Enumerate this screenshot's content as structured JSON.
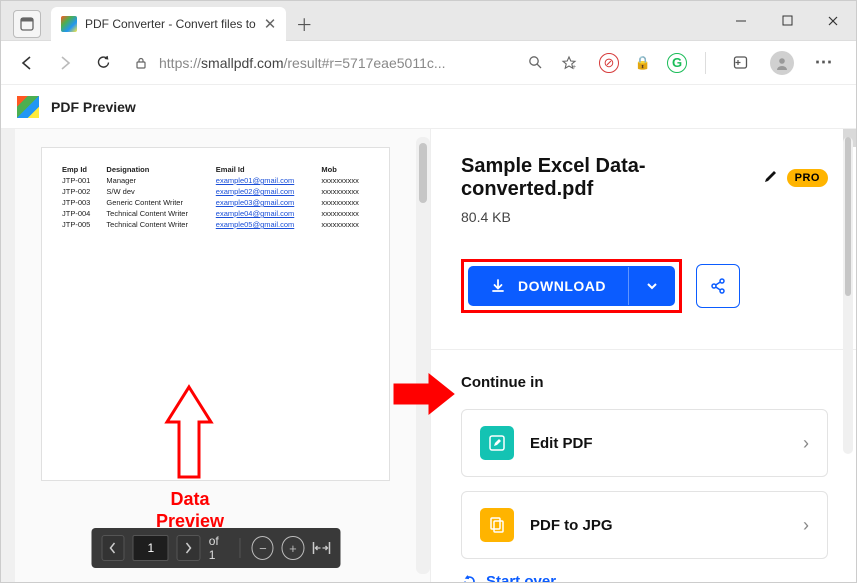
{
  "window": {
    "tab_title": "PDF Converter - Convert files to ",
    "url_prefix": "https://",
    "url_host": "smallpdf.com",
    "url_path": "/result#r=5717eae5011c..."
  },
  "app": {
    "title": "PDF Preview"
  },
  "preview": {
    "columns": [
      "Emp Id",
      "Designation",
      "Email Id",
      "Mob"
    ],
    "rows": [
      {
        "id": "JTP-001",
        "desig": "Manager",
        "email": "example01@gmail.com",
        "mob": "xxxxxxxxxx"
      },
      {
        "id": "JTP-002",
        "desig": "S/W dev",
        "email": "example02@gmail.com",
        "mob": "xxxxxxxxxx"
      },
      {
        "id": "JTP-003",
        "desig": "Generic Content Writer",
        "email": "example03@gmail.com",
        "mob": "xxxxxxxxxx"
      },
      {
        "id": "JTP-004",
        "desig": "Technical Content Writer",
        "email": "example04@gmail.com",
        "mob": "xxxxxxxxxx"
      },
      {
        "id": "JTP-005",
        "desig": "Technical Content Writer",
        "email": "example05@gmail.com",
        "mob": "xxxxxxxxxx"
      }
    ],
    "annotation_line1": "Data",
    "annotation_line2": "Preview",
    "toolbar": {
      "page": "1",
      "of": "of 1"
    }
  },
  "result": {
    "filename": "Sample Excel Data-converted.pdf",
    "pro": "PRO",
    "size": "80.4 KB",
    "download": "DOWNLOAD",
    "continue": "Continue in",
    "edit_pdf": "Edit PDF",
    "pdf_to_jpg": "PDF to JPG",
    "start_over": "Start over"
  }
}
